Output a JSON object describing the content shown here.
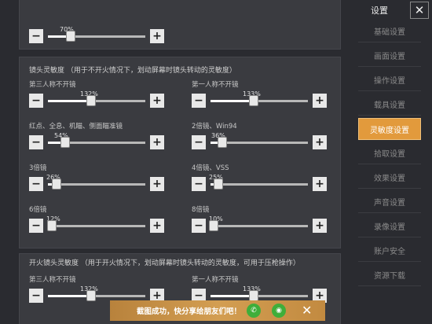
{
  "sidebar": {
    "title": "设置",
    "close_glyph": "✕",
    "active_color": "#e29a3c",
    "items": [
      {
        "label": "基础设置",
        "active": false
      },
      {
        "label": "画面设置",
        "active": false
      },
      {
        "label": "操作设置",
        "active": false
      },
      {
        "label": "载具设置",
        "active": false
      },
      {
        "label": "灵敏度设置",
        "active": true
      },
      {
        "label": "拾取设置",
        "active": false
      },
      {
        "label": "效果设置",
        "active": false
      },
      {
        "label": "声音设置",
        "active": false
      },
      {
        "label": "录像设置",
        "active": false
      },
      {
        "label": "账户安全",
        "active": false
      },
      {
        "label": "资源下载",
        "active": false
      }
    ]
  },
  "top_slider": {
    "value": 70,
    "value_text": "70%"
  },
  "camera_section": {
    "title": "镜头灵敏度  （用于不开火情况下，划动屏幕时镜头转动的灵敏度）",
    "sliders": [
      {
        "label": "第三人称不开镜",
        "value": 132,
        "value_text": "132%"
      },
      {
        "label": "第一人称不开镜",
        "value": 133,
        "value_text": "133%"
      },
      {
        "label": "红点、全息、机瞄、侧面瞄准镜",
        "value": 54,
        "value_text": "54%"
      },
      {
        "label": "2倍镜、Win94",
        "value": 36,
        "value_text": "36%"
      },
      {
        "label": "3倍镜",
        "value": 26,
        "value_text": "26%"
      },
      {
        "label": "4倍镜、VSS",
        "value": 25,
        "value_text": "25%"
      },
      {
        "label": "6倍镜",
        "value": 12,
        "value_text": "12%"
      },
      {
        "label": "8倍镜",
        "value": 10,
        "value_text": "10%"
      }
    ]
  },
  "fire_section": {
    "title": "开火镜头灵敏度  （用于开火情况下，划动屏幕时镜头转动的灵敏度，可用于压枪操作）",
    "sliders": [
      {
        "label": "第三人称不开镜",
        "value": 132,
        "value_text": "132%"
      },
      {
        "label": "第一人称不开镜",
        "value": 133,
        "value_text": "133%"
      }
    ]
  },
  "slider_max": 300,
  "buttons": {
    "minus": "−",
    "plus": "+"
  },
  "toast": {
    "text": "截图成功，快分享给朋友们吧！",
    "icons": [
      "wechat-icon",
      "moments-icon"
    ],
    "close_glyph": "✕"
  }
}
